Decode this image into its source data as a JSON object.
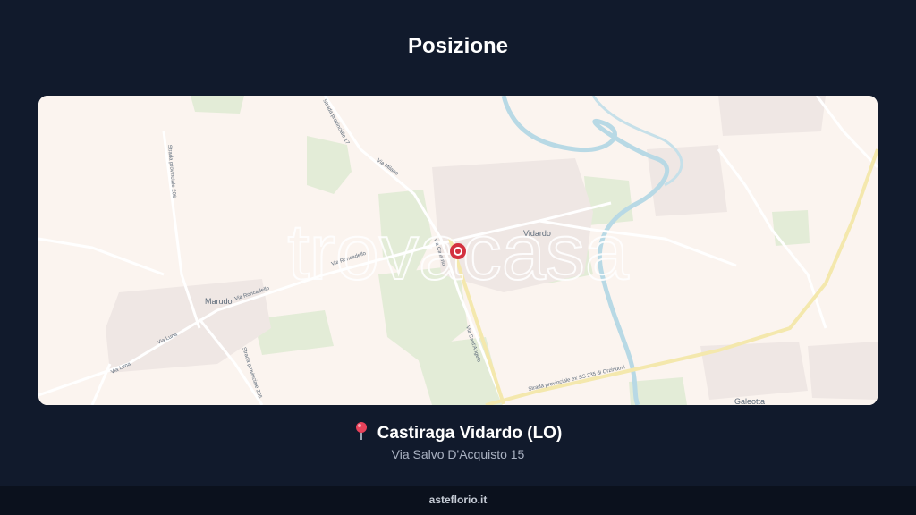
{
  "page": {
    "title": "Posizione"
  },
  "map": {
    "labels": {
      "vidardo": "Vidardo",
      "marudo": "Marudo",
      "galeotta": "Galeotta",
      "via_milano": "Via Milano",
      "via_roncadello": "Via Roncadello",
      "via_roncadello_2": "Via Roncadello",
      "via_sant_angelo": "Via Sant'Angelo",
      "via_lodi_marudo": "Via Luna",
      "via_luna": "Via Luna",
      "via_leo": "Via Luna",
      "sp_17": "Strada provinciale 17",
      "sp_235": "Strada provinciale ex SS 235 di Orzinuovi",
      "sp_205": "Strada provinciale 205",
      "sp_206": "Strada provinciale 206",
      "via_cassino": "Via Cassino"
    },
    "watermark": "trovacasa",
    "colors": {
      "background": "#fbf4ef",
      "green": "#dfe9d3",
      "river": "#b5d8e4",
      "road_major": "#f3e6a3",
      "marker": "#d3313f"
    },
    "marker_icon": "location-marker-icon"
  },
  "location": {
    "icon": "pushpin-icon",
    "name": "Castiraga Vidardo (LO)",
    "address": "Via Salvo D'Acquisto 15"
  },
  "footer": {
    "brand": "asteflorio.it"
  }
}
